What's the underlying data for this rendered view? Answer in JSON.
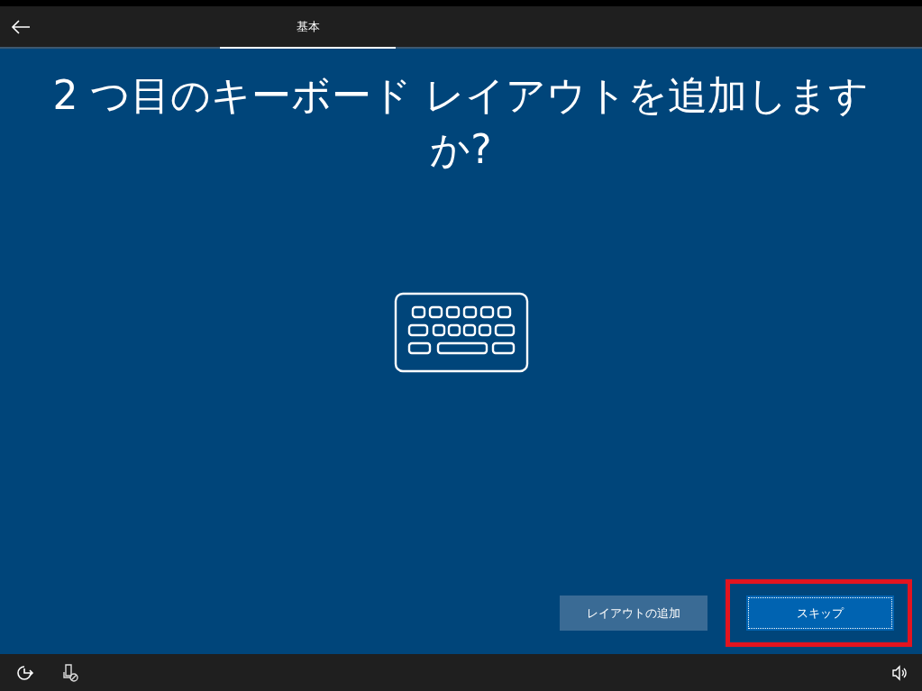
{
  "header": {
    "tabs": [
      {
        "label": "基本",
        "selected": true
      }
    ]
  },
  "title": "2 つ目のキーボード レイアウトを追加しますか?",
  "buttons": [
    {
      "label": "レイアウトの追加",
      "kind": "secondary",
      "focused": false,
      "highlighted": false
    },
    {
      "label": "スキップ",
      "kind": "primary",
      "focused": true,
      "highlighted": true
    }
  ]
}
